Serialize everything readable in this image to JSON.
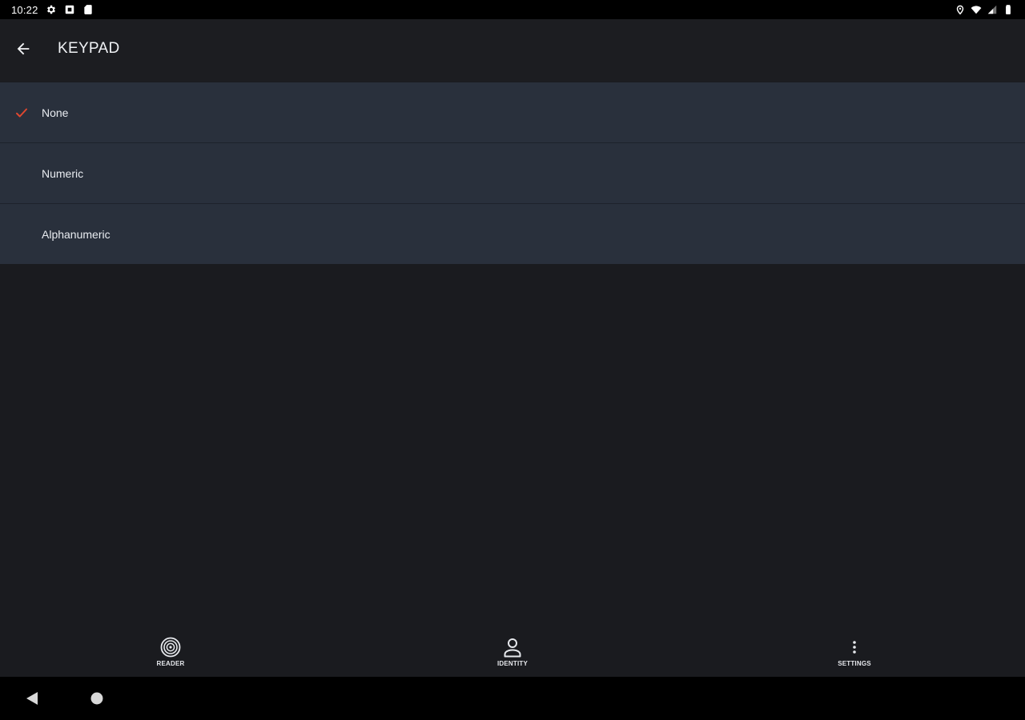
{
  "status_bar": {
    "time": "10:22",
    "left_icons": [
      "settings-gear-icon",
      "notification-square-icon",
      "sd-card-icon"
    ],
    "right_icons": [
      "location-icon",
      "wifi-icon",
      "signal-icon",
      "battery-icon"
    ]
  },
  "app_bar": {
    "back_icon": "arrow-back-icon",
    "title": "KEYPAD"
  },
  "options": [
    {
      "label": "None",
      "selected": true
    },
    {
      "label": "Numeric",
      "selected": false
    },
    {
      "label": "Alphanumeric",
      "selected": false
    }
  ],
  "bottom_nav": [
    {
      "label": "READER",
      "icon": "reader-target-icon"
    },
    {
      "label": "IDENTITY",
      "icon": "person-icon"
    },
    {
      "label": "SETTINGS",
      "icon": "more-vertical-icon"
    }
  ],
  "colors": {
    "background": "#1a1b1f",
    "list_item": "#29303c",
    "check_accent": "#e0472f",
    "status_bar": "#000000"
  }
}
